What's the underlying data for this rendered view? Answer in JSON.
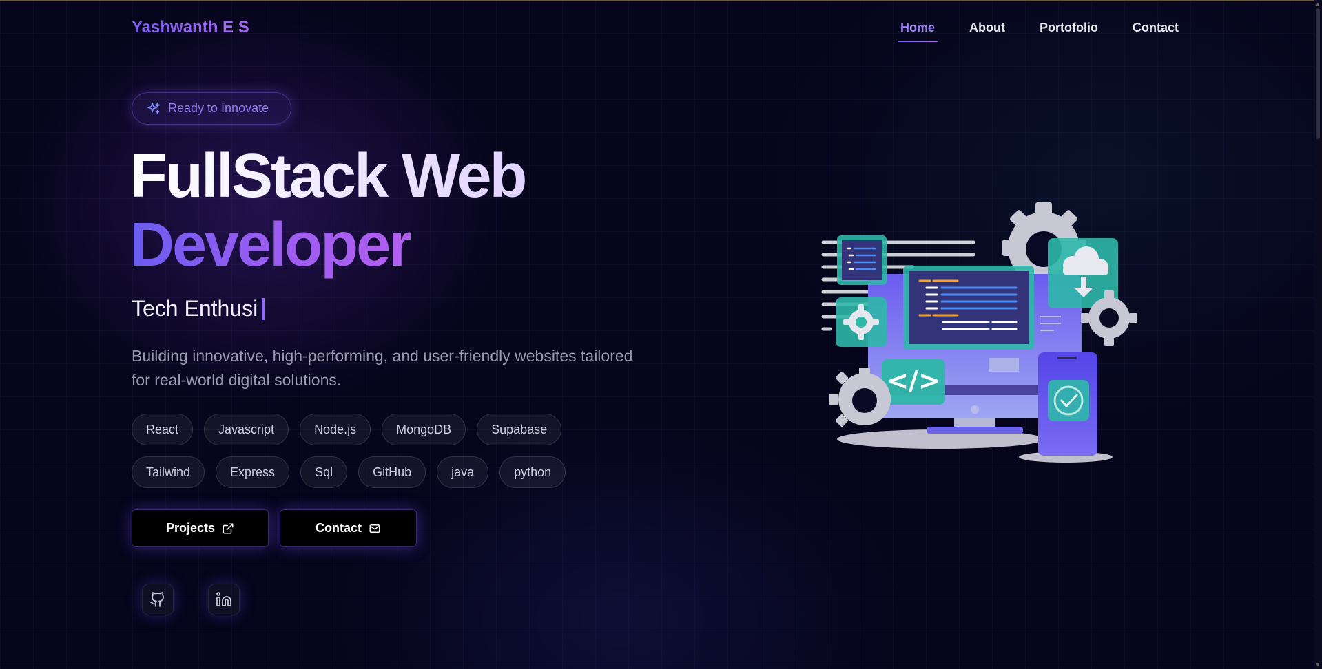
{
  "brand": {
    "name": "Yashwanth E S"
  },
  "nav": {
    "items": [
      {
        "label": "Home",
        "active": true
      },
      {
        "label": "About",
        "active": false
      },
      {
        "label": "Portofolio",
        "active": false
      },
      {
        "label": "Contact",
        "active": false
      }
    ]
  },
  "hero": {
    "badge": {
      "label": "Ready to Innovate",
      "icon": "sparkles-icon"
    },
    "title_line1": "FullStack Web",
    "title_line2": "Developer",
    "typed_text": "Tech Enthusi",
    "description": "Building innovative, high-performing, and user-friendly websites tailored for real-world digital solutions.",
    "tags_row1": [
      "React",
      "Javascript",
      "Node.js",
      "MongoDB",
      "Supabase"
    ],
    "tags_row2": [
      "Tailwind",
      "Express",
      "Sql",
      "GitHub",
      "java",
      "python"
    ],
    "buttons": {
      "projects": {
        "label": "Projects",
        "icon": "external-link-icon"
      },
      "contact": {
        "label": "Contact",
        "icon": "mail-icon"
      }
    },
    "social": [
      {
        "name": "github",
        "icon": "github-icon"
      },
      {
        "name": "linkedin",
        "icon": "linkedin-icon"
      }
    ]
  },
  "colors": {
    "accent": "#8b5cf6",
    "accent_blue": "#6366f1",
    "background": "#06051b",
    "teal": "#2bb5a8"
  }
}
